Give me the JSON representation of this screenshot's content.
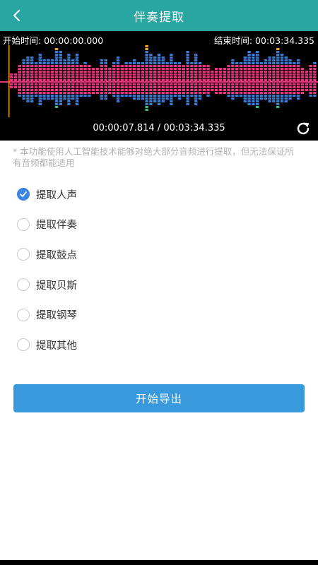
{
  "header": {
    "title": "伴奏提取",
    "back_icon": "chevron-left-icon",
    "background": "#2aa6a2"
  },
  "waveform": {
    "start_label": "开始时间: 00:00:00.000",
    "end_label": "结束时间: 00:03:34.335",
    "playback": "00:00:07.814 / 00:03:34.335",
    "refresh_icon": "refresh-icon",
    "colors": {
      "top": "#f2a51c",
      "upper": "#3a7bd5",
      "center": "#e8347e",
      "lower": "#2fbf7a",
      "playhead": "#f39c12"
    }
  },
  "notice": "* 本功能使用人工智能技术能够对绝大部分音频进行提取，但无法保证所有音频都能适用",
  "options": [
    {
      "label": "提取人声",
      "checked": true
    },
    {
      "label": "提取伴奏",
      "checked": false
    },
    {
      "label": "提取鼓点",
      "checked": false
    },
    {
      "label": "提取贝斯",
      "checked": false
    },
    {
      "label": "提取钢琴",
      "checked": false
    },
    {
      "label": "提取其他",
      "checked": false
    }
  ],
  "export_button": {
    "label": "开始导出",
    "color": "#3899dc"
  },
  "accent_color": "#3b84e2"
}
